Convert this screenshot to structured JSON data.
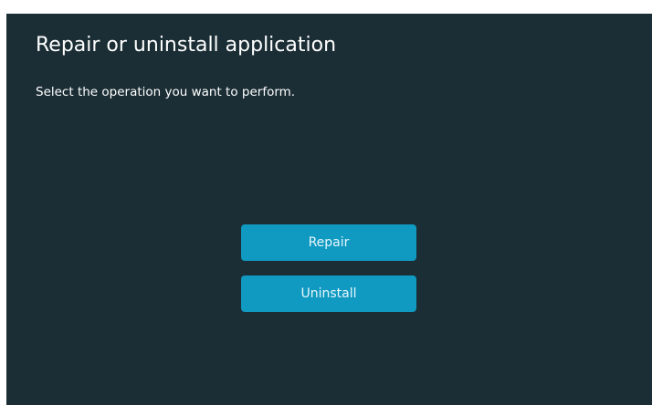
{
  "dialog": {
    "title": "Repair or uninstall application",
    "subtitle": "Select the operation you want to perform.",
    "buttons": {
      "repair_label": "Repair",
      "uninstall_label": "Uninstall"
    }
  },
  "colors": {
    "background": "#1b2e35",
    "button": "#109ac2",
    "text": "#ffffff"
  }
}
